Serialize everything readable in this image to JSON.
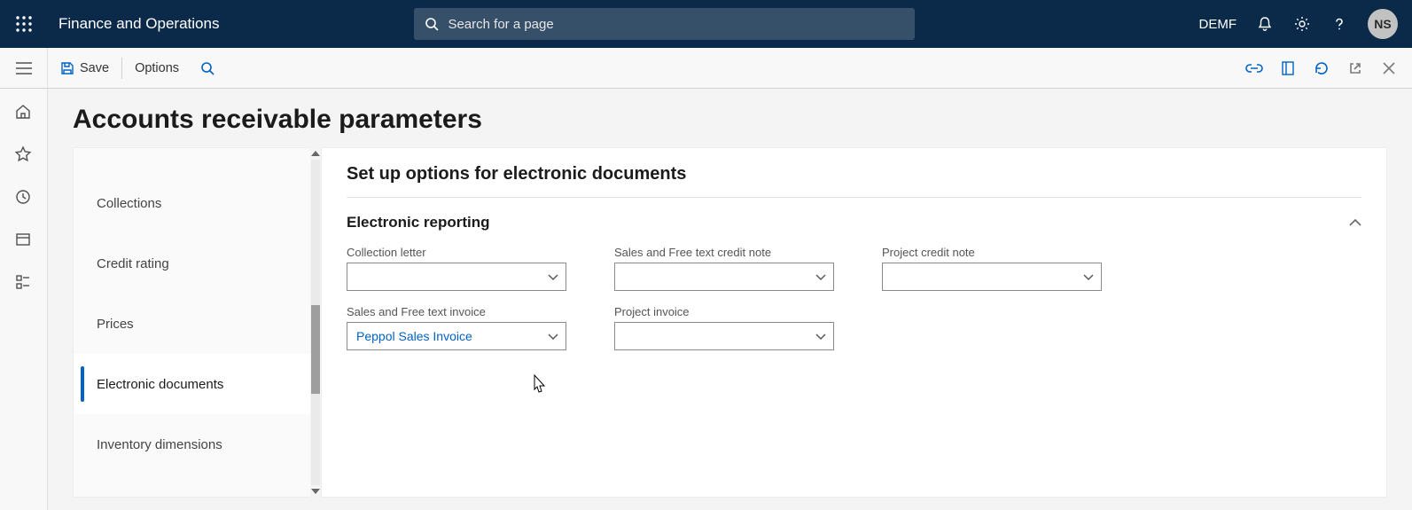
{
  "header": {
    "app_title": "Finance and Operations",
    "search_placeholder": "Search for a page",
    "company": "DEMF",
    "avatar_initials": "NS"
  },
  "commandbar": {
    "save_label": "Save",
    "options_label": "Options"
  },
  "page": {
    "title": "Accounts receivable parameters"
  },
  "tabs": {
    "items": [
      {
        "label": "Collections",
        "active": false
      },
      {
        "label": "Credit rating",
        "active": false
      },
      {
        "label": "Prices",
        "active": false
      },
      {
        "label": "Electronic documents",
        "active": true
      },
      {
        "label": "Inventory dimensions",
        "active": false
      }
    ]
  },
  "form": {
    "section_caption": "Set up options for electronic documents",
    "group_title": "Electronic reporting",
    "fields": {
      "collection_letter_label": "Collection letter",
      "collection_letter_value": "",
      "sales_credit_note_label": "Sales and Free text credit note",
      "sales_credit_note_value": "",
      "project_credit_note_label": "Project credit note",
      "project_credit_note_value": "",
      "sales_invoice_label": "Sales and Free text invoice",
      "sales_invoice_value": "Peppol Sales Invoice",
      "project_invoice_label": "Project invoice",
      "project_invoice_value": ""
    }
  }
}
